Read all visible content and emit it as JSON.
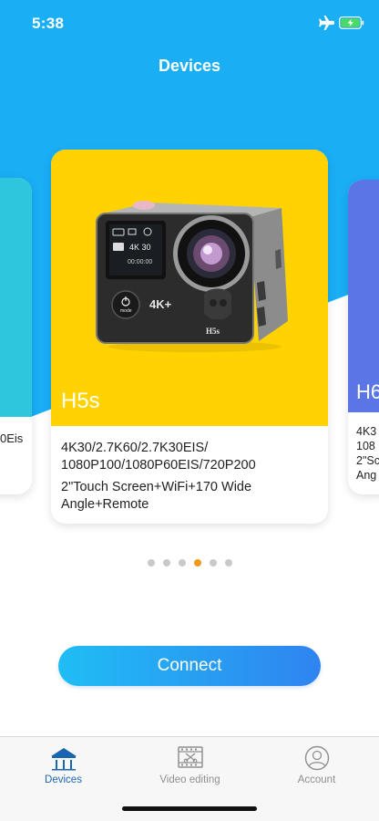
{
  "status_bar": {
    "time": "5:38"
  },
  "header": {
    "title": "Devices"
  },
  "cards": {
    "left": {
      "specs": [
        "0Eis"
      ]
    },
    "main": {
      "name": "H5s",
      "specs": [
        "4K30/2.7K60/2.7K30EIS/",
        "1080P100/1080P60EIS/720P200",
        "2\"Touch Screen+WiFi+170 Wide",
        "Angle+Remote"
      ],
      "camera_screen": {
        "res": "4K 30",
        "time": "00:00:00"
      },
      "camera_badge": "4K+",
      "camera_model": "H5s",
      "camera_button": "mode"
    },
    "right": {
      "name": "H6",
      "specs": [
        "4K3",
        "108",
        "2\"Sc",
        "Ang"
      ]
    }
  },
  "pagination": {
    "count": 6,
    "active_index": 3
  },
  "connect_button": {
    "label": "Connect"
  },
  "tabbar": {
    "items": [
      {
        "label": "Devices",
        "icon": "house-icon",
        "active": true
      },
      {
        "label": "Video editing",
        "icon": "film-scissors-icon",
        "active": false
      },
      {
        "label": "Account",
        "icon": "user-circle-icon",
        "active": false
      }
    ]
  },
  "colors": {
    "sky_blue": "#1aaef5",
    "main_card": "#ffd200",
    "left_card": "#2ec6dc",
    "right_card": "#5a76e6",
    "active_dot": "#f39a1a",
    "active_tab": "#1a66b0"
  }
}
